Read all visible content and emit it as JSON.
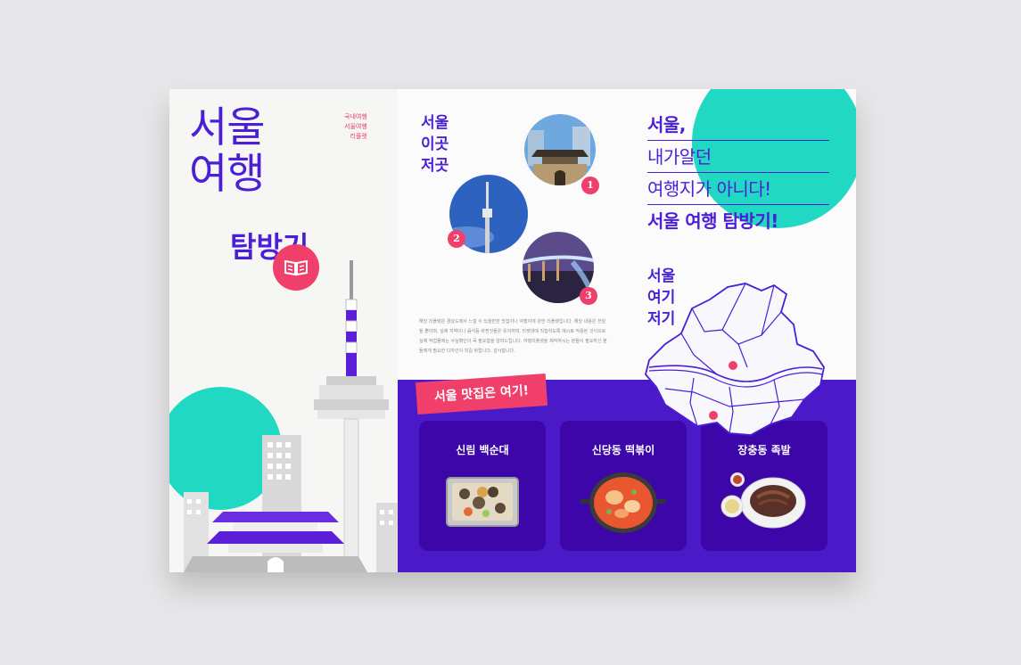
{
  "panel1": {
    "title_line1": "서울",
    "title_line2": "여행",
    "title_line3": "탐방기",
    "side_line1": "국내여행",
    "side_line2": "서울여행",
    "side_line3": "리플렛",
    "book_icon": "open-book-icon"
  },
  "panel2": {
    "heading_line1": "서울",
    "heading_line2": "이곳",
    "heading_line3": "저곳",
    "photos": [
      {
        "badge": "1",
        "subject": "south gate"
      },
      {
        "badge": "2",
        "subject": "seoul tower"
      },
      {
        "badge": "3",
        "subject": "bridge at night"
      }
    ],
    "body_text": "해당 리플렛은 경상도에서 느낄 수 있을만한 맛집이나 여행지에 관한 리플렛입니다. 해당 내용은 전달될 뿐이며, 실제 지역이나 음식등 바뀐것들은 유의하며, 타켓대에 직합하도록 예시로 작용된 것이므로 실제 작업물에는 사실확인이 꼭 필요함을 알려드립니다. 여행리플렛을 제작하시는 분들이 필요하신 분들에게 필요한 디자인이 되길 바랍니다. 감사합니다."
  },
  "panel3": {
    "line1": "서울,",
    "line2": "내가알던",
    "line3": "여행지가 아니다!",
    "line4": "서울 여행 탐방기!",
    "map_heading_line1": "서울",
    "map_heading_line2": "여기",
    "map_heading_line3": "저기"
  },
  "band": {
    "tag": "서울 맛집은 여기!",
    "cards": [
      {
        "title": "신림 백순대"
      },
      {
        "title": "신당동 떡볶이"
      },
      {
        "title": "장충동 족발"
      }
    ]
  },
  "colors": {
    "purple": "#4a1fd6",
    "band_purple": "#4a1ac8",
    "card_purple": "#3d06a8",
    "pink": "#f03f6b",
    "teal": "#21d9c2"
  }
}
